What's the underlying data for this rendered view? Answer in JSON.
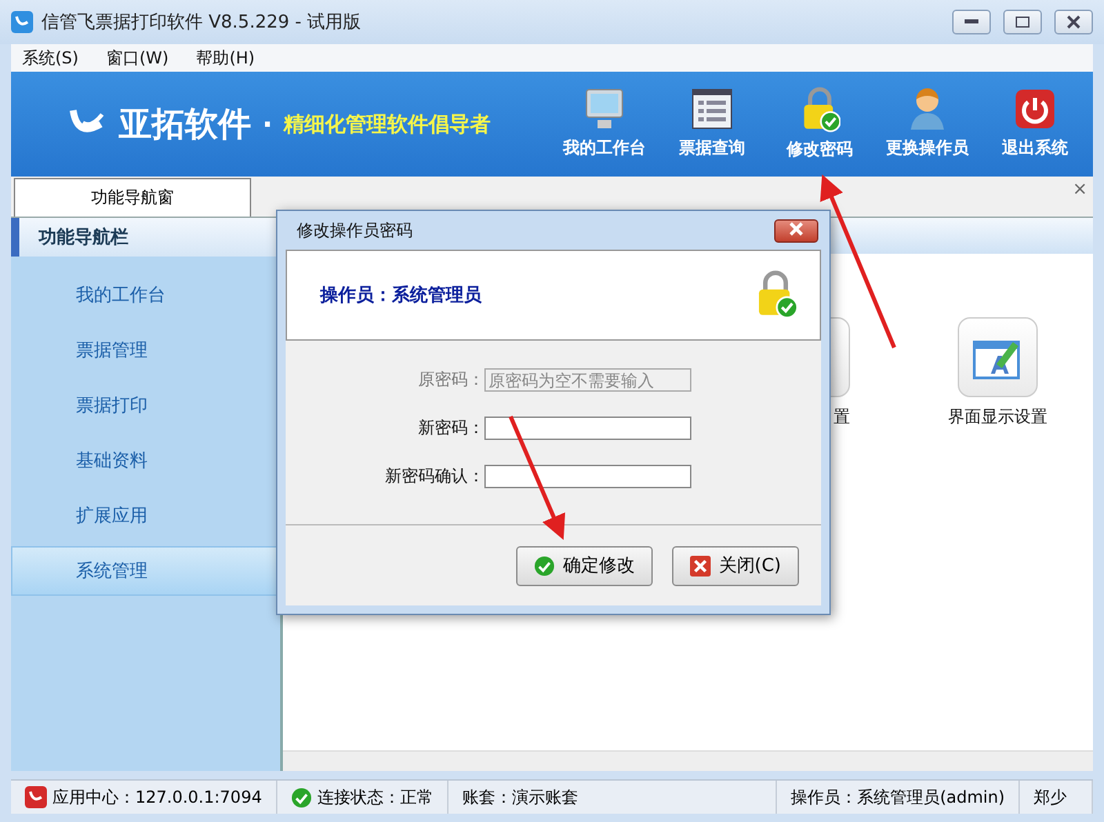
{
  "window": {
    "title": "信管飞票据打印软件 V8.5.229 - 试用版"
  },
  "menu": [
    "系统(S)",
    "窗口(W)",
    "帮助(H)"
  ],
  "banner": {
    "brand": "亚拓软件",
    "dot": "·",
    "slogan": "精细化管理软件倡导者"
  },
  "toolbar": [
    {
      "label": "我的工作台",
      "kind": "monitor"
    },
    {
      "label": "票据查询",
      "kind": "list"
    },
    {
      "label": "修改密码",
      "kind": "lock"
    },
    {
      "label": "更换操作员",
      "kind": "user"
    },
    {
      "label": "退出系统",
      "kind": "power"
    }
  ],
  "tabs": [
    {
      "label": "功能导航窗",
      "selected": true
    }
  ],
  "tab_close": "×",
  "sidebar": {
    "title": "功能导航栏",
    "items": [
      {
        "label": "我的工作台",
        "selected": false
      },
      {
        "label": "票据管理",
        "selected": false
      },
      {
        "label": "票据打印",
        "selected": false
      },
      {
        "label": "基础资料",
        "selected": false
      },
      {
        "label": "扩展应用",
        "selected": false
      },
      {
        "label": "系统管理",
        "selected": true
      }
    ]
  },
  "tiles": [
    {
      "label": "置",
      "kind": "hidden"
    },
    {
      "label": "界面显示设置",
      "kind": "display"
    }
  ],
  "dialog": {
    "title": "修改操作员密码",
    "operator": "操作员：系统管理员",
    "fields": [
      {
        "label": "原密码：",
        "placeholder": "原密码为空不需要输入",
        "disabled": true
      },
      {
        "label": "新密码：",
        "disabled": false
      },
      {
        "label": "新密码确认：",
        "disabled": false
      }
    ],
    "buttons": [
      {
        "label": "确定修改",
        "kind": "ok"
      },
      {
        "label": "关闭(C)",
        "kind": "close"
      }
    ]
  },
  "status_bar": [
    {
      "text": "应用中心：127.0.0.1:7094",
      "kind": "logo"
    },
    {
      "text": "连接状态：正常",
      "kind": "ok"
    },
    {
      "text": "账套：演示账套",
      "kind": "plain"
    },
    {
      "text": "操作员：系统管理员(admin)",
      "kind": "plain"
    },
    {
      "text": "郑少",
      "kind": "plain"
    }
  ]
}
